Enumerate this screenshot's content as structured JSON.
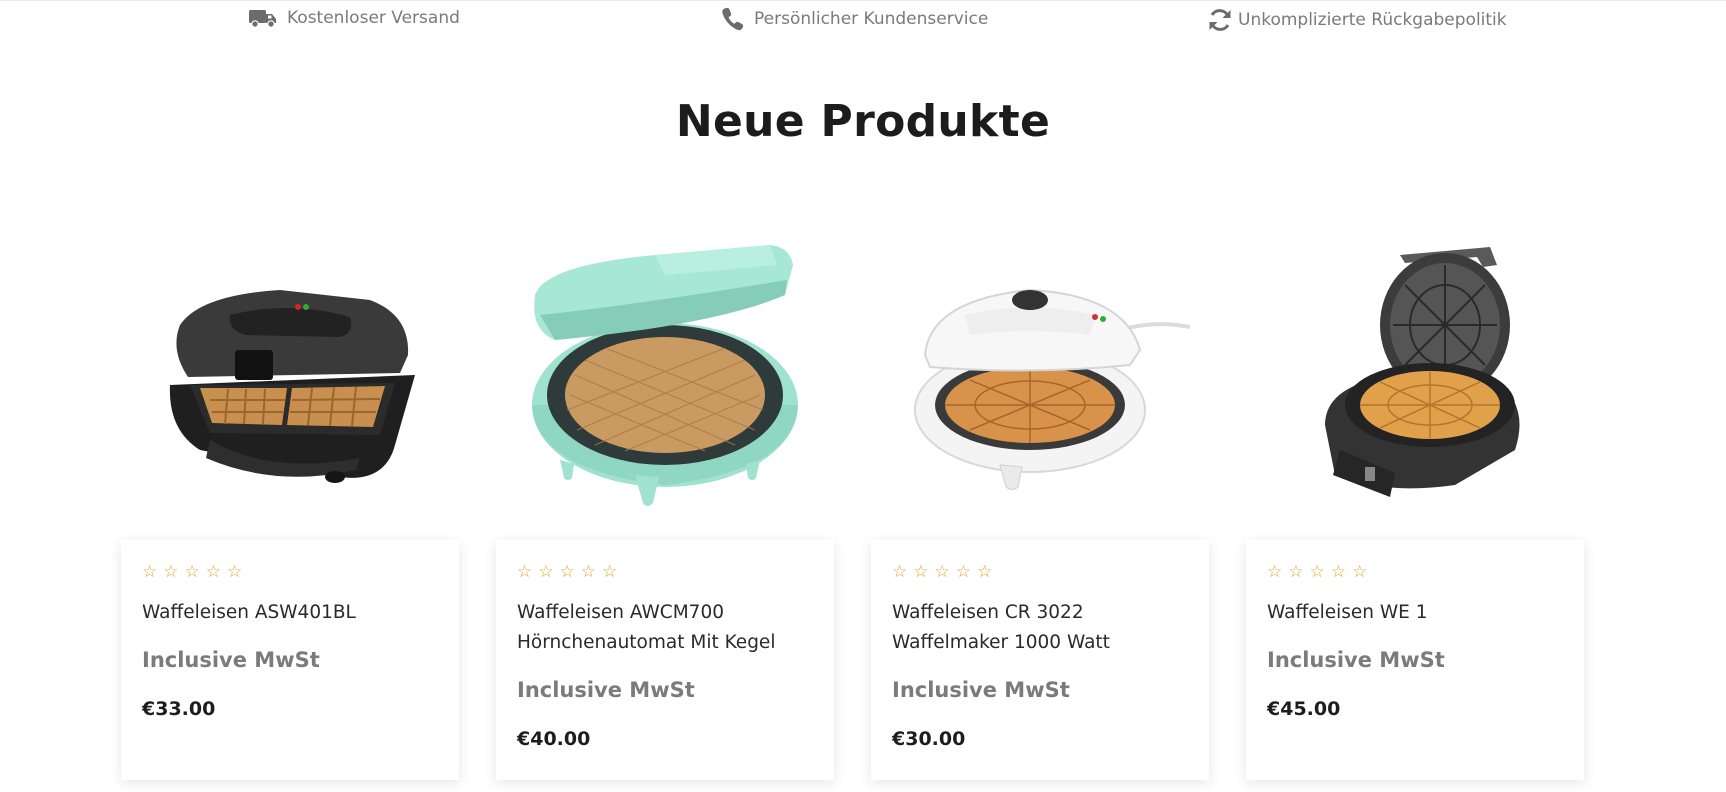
{
  "features": [
    {
      "icon": "truck-icon",
      "label": "Kostenloser Versand"
    },
    {
      "icon": "phone-icon",
      "label": "Persönlicher Kundenservice"
    },
    {
      "icon": "refresh-icon",
      "label": "Unkomplizierte Rückgabepolitik"
    }
  ],
  "section": {
    "title": "Neue Produkte"
  },
  "products": [
    {
      "name": "Waffeleisen ASW401BL",
      "vat": "Inclusive MwSt",
      "price": "€33.00",
      "rating": 0,
      "stars": 5,
      "image": "black rectangular waffle iron"
    },
    {
      "name": "Waffeleisen AWCM700 Hörnchenautomat Mit Kegel",
      "vat": "Inclusive MwSt",
      "price": "€40.00",
      "rating": 0,
      "stars": 5,
      "image": "mint round cone maker"
    },
    {
      "name": "Waffeleisen CR 3022 Waffelmaker 1000 Watt",
      "vat": "Inclusive MwSt",
      "price": "€30.00",
      "rating": 0,
      "stars": 5,
      "image": "white heart waffle maker"
    },
    {
      "name": "Waffeleisen WE 1",
      "vat": "Inclusive MwSt",
      "price": "€45.00",
      "rating": 0,
      "stars": 5,
      "image": "dark heart waffle iron"
    }
  ],
  "colors": {
    "star": "#e0a531",
    "muted_text": "#7a7a7a",
    "heading": "#1c1c1c",
    "mint": "#9ee3cf"
  }
}
